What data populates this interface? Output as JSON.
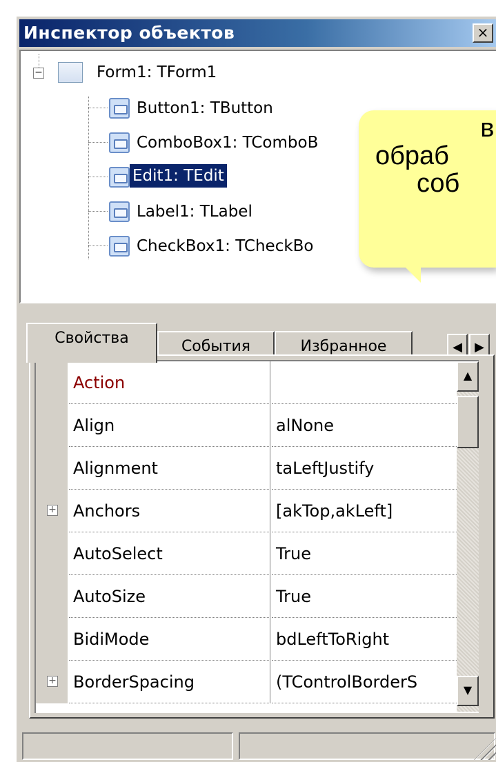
{
  "window": {
    "title": "Инспектор объектов",
    "close_glyph": "×"
  },
  "tree": {
    "root": {
      "label": "Form1: TForm1",
      "expander": "−"
    },
    "items": [
      {
        "label": "Button1: TButton",
        "selected": false
      },
      {
        "label": "ComboBox1: TComboB",
        "selected": false
      },
      {
        "label": "Edit1: TEdit",
        "selected": true
      },
      {
        "label": "Label1: TLabel",
        "selected": false
      },
      {
        "label": "CheckBox1: TCheckBo",
        "selected": false
      }
    ]
  },
  "callout": {
    "lines": [
      "вы",
      "обраб",
      "соб"
    ]
  },
  "tabs": {
    "items": [
      {
        "label": "Свойства",
        "active": true
      },
      {
        "label": "События",
        "active": false
      },
      {
        "label": "Избранное",
        "active": false
      }
    ],
    "left_arrow": "◀",
    "right_arrow": "▶"
  },
  "properties": {
    "rows": [
      {
        "name": "Action",
        "value": "",
        "expandable": false,
        "event_style": true
      },
      {
        "name": "Align",
        "value": "alNone",
        "expandable": false,
        "event_style": false
      },
      {
        "name": "Alignment",
        "value": "taLeftJustify",
        "expandable": false,
        "event_style": false
      },
      {
        "name": "Anchors",
        "value": "[akTop,akLeft]",
        "expandable": true,
        "event_style": false
      },
      {
        "name": "AutoSelect",
        "value": "True",
        "expandable": false,
        "event_style": false
      },
      {
        "name": "AutoSize",
        "value": "True",
        "expandable": false,
        "event_style": false
      },
      {
        "name": "BidiMode",
        "value": "bdLeftToRight",
        "expandable": false,
        "event_style": false
      },
      {
        "name": "BorderSpacing",
        "value": "(TControlBorderS",
        "expandable": true,
        "event_style": false
      }
    ],
    "plus_glyph": "+",
    "scroll_up": "▲",
    "scroll_down": "▼"
  },
  "colors": {
    "selection": "#0a246a",
    "event_name": "#8b0000",
    "callout_bg": "#ffff99",
    "face": "#d4d0c8"
  }
}
